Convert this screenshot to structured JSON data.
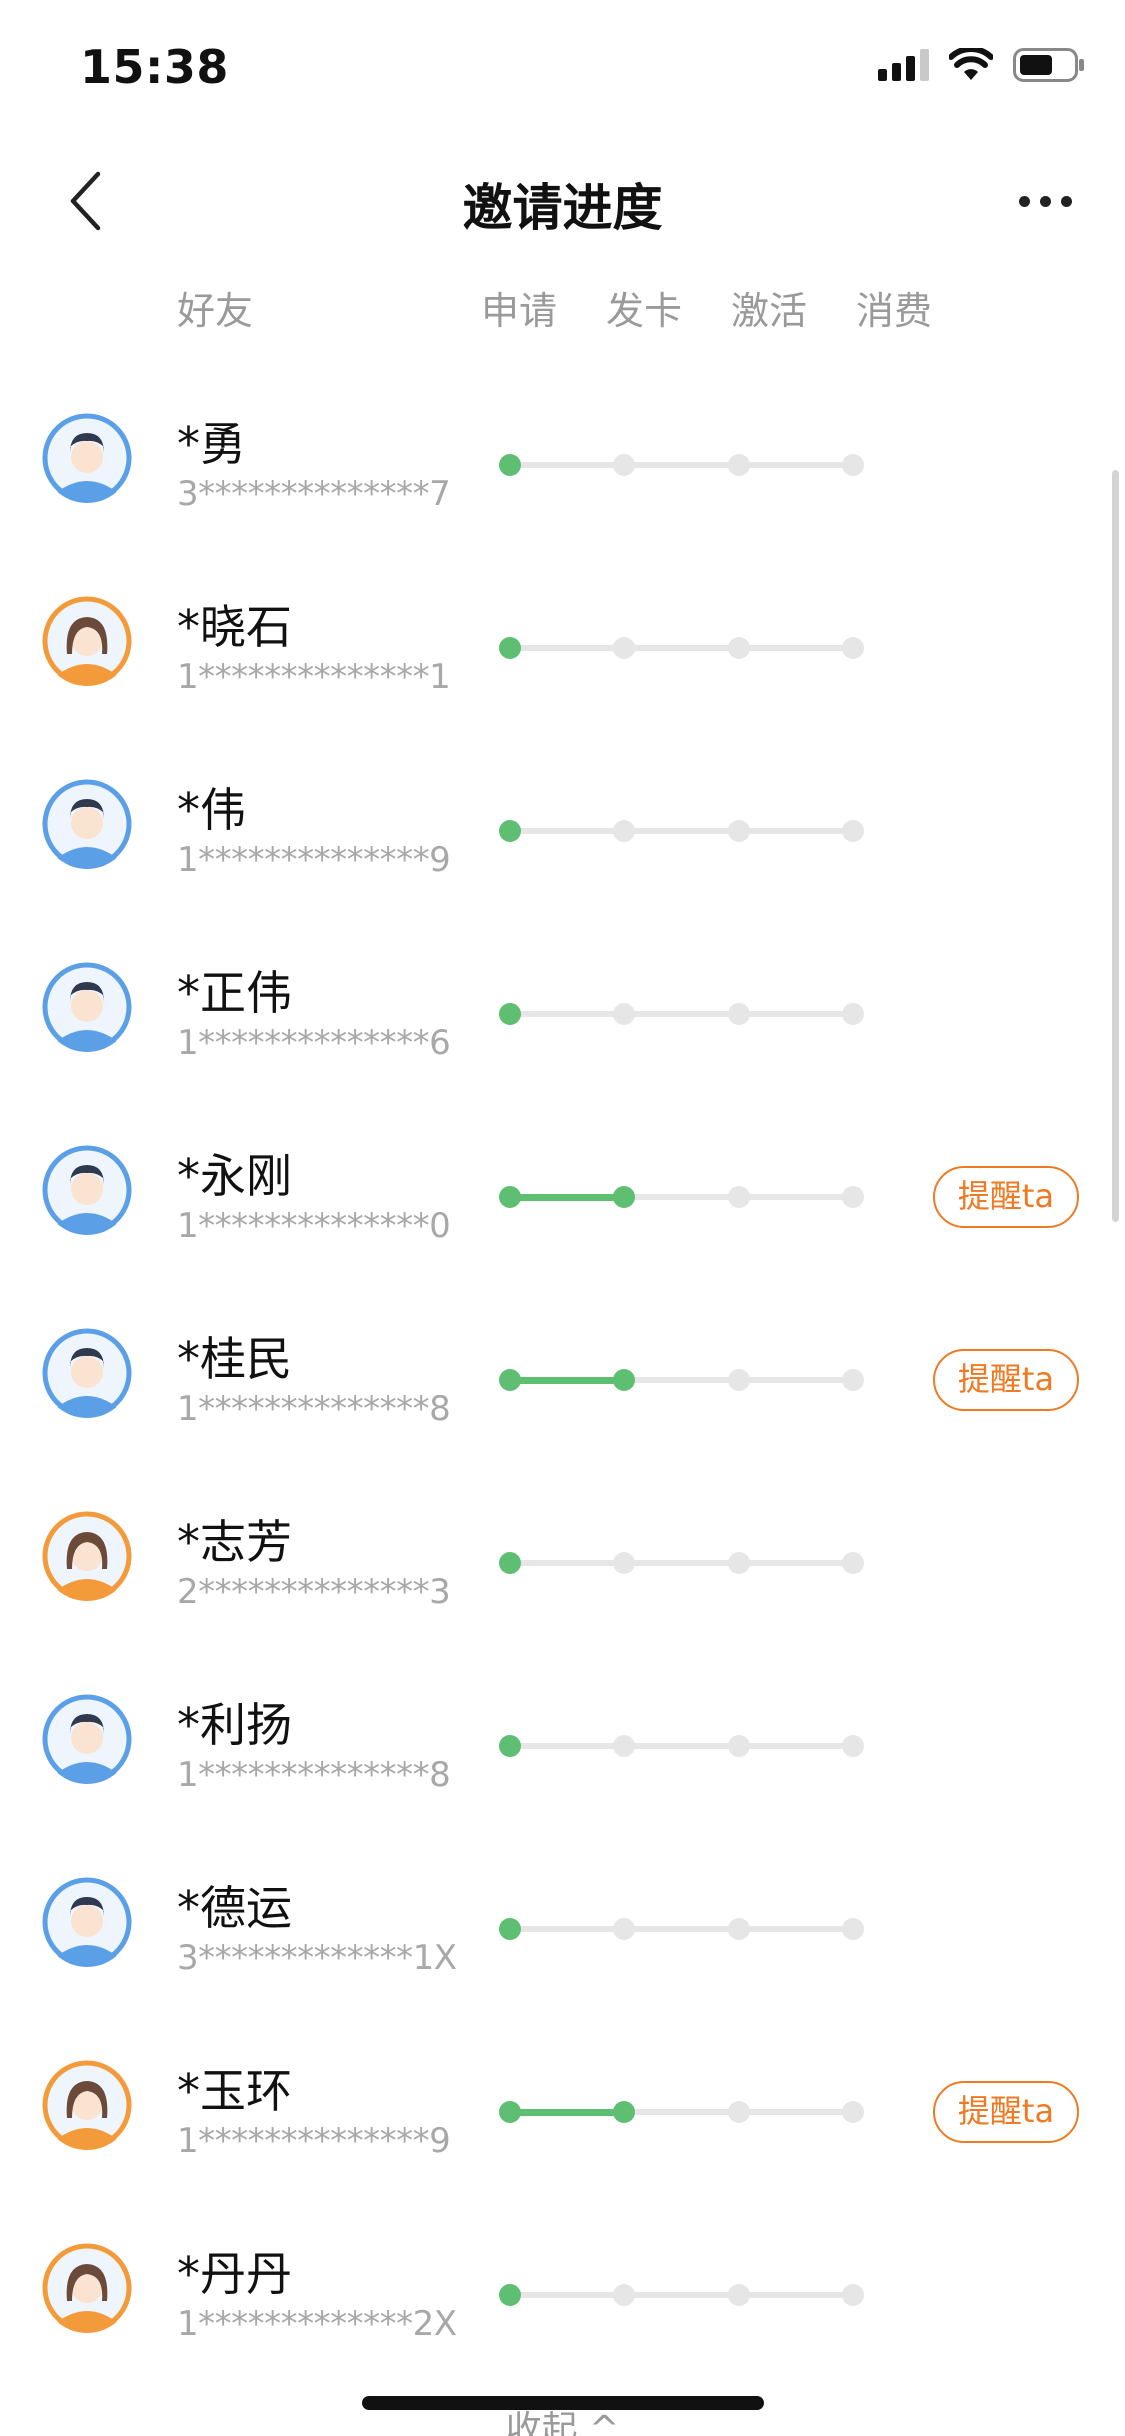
{
  "status_bar": {
    "time": "15:38",
    "signal_icon": "cellular-signal-icon",
    "wifi_icon": "wifi-icon",
    "battery_icon": "battery-icon"
  },
  "nav": {
    "back_icon": "chevron-left-icon",
    "title": "邀请进度",
    "more_icon": "more-horizontal-icon"
  },
  "columns": {
    "friend": "好友",
    "steps": [
      "申请",
      "发卡",
      "激活",
      "消费"
    ]
  },
  "colors": {
    "progress_done": "#5ebf72",
    "progress_pending": "#e6e6e6",
    "remind_accent": "#f07a23",
    "male_avatar_ring": "#5b9fe6",
    "female_avatar_ring": "#f39a3a"
  },
  "remind_label": "提醒ta",
  "friends": [
    {
      "name": "*勇",
      "id": "3**************7",
      "avatar": "male-avatar",
      "steps_done": 1,
      "remind": false
    },
    {
      "name": "*晓石",
      "id": "1**************1",
      "avatar": "female-avatar",
      "steps_done": 1,
      "remind": false
    },
    {
      "name": "*伟",
      "id": "1**************9",
      "avatar": "male-avatar",
      "steps_done": 1,
      "remind": false
    },
    {
      "name": "*正伟",
      "id": "1**************6",
      "avatar": "male-avatar",
      "steps_done": 1,
      "remind": false
    },
    {
      "name": "*永刚",
      "id": "1**************0",
      "avatar": "male-avatar",
      "steps_done": 2,
      "remind": true
    },
    {
      "name": "*桂民",
      "id": "1**************8",
      "avatar": "male-avatar",
      "steps_done": 2,
      "remind": true
    },
    {
      "name": "*志芳",
      "id": "2**************3",
      "avatar": "female-avatar",
      "steps_done": 1,
      "remind": false
    },
    {
      "name": "*利扬",
      "id": "1**************8",
      "avatar": "male-avatar",
      "steps_done": 1,
      "remind": false
    },
    {
      "name": "*德运",
      "id": "3*************1X",
      "avatar": "male-avatar",
      "steps_done": 1,
      "remind": false
    },
    {
      "name": "*玉环",
      "id": "1**************9",
      "avatar": "female-avatar",
      "steps_done": 2,
      "remind": true
    },
    {
      "name": "*丹丹",
      "id": "1*************2X",
      "avatar": "female-avatar",
      "steps_done": 1,
      "remind": false
    }
  ],
  "collapse_label": "收起",
  "collapse_icon": "chevron-up-icon"
}
